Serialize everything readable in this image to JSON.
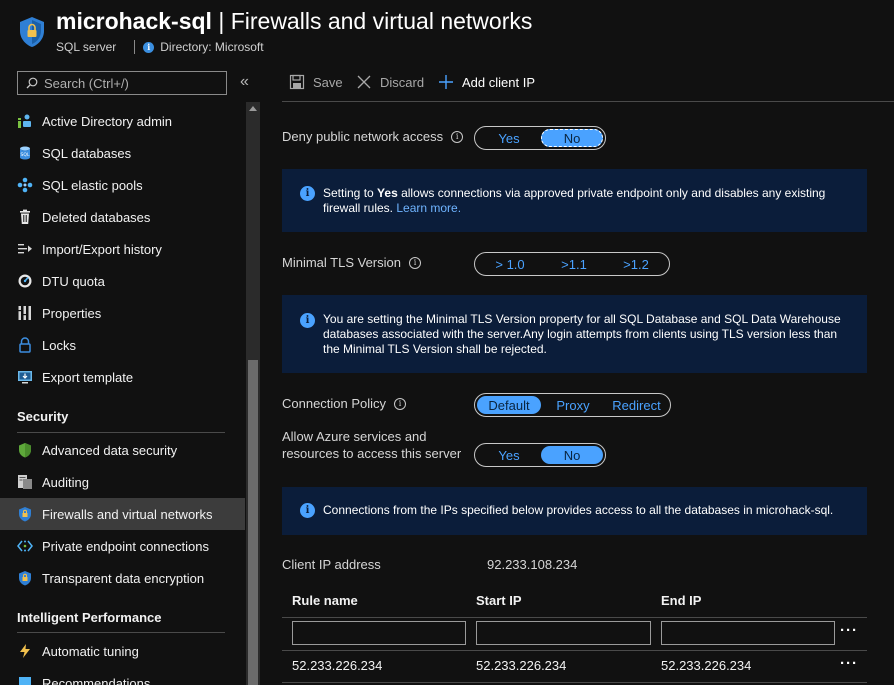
{
  "header": {
    "resource_name": "microhack-sql",
    "page_title": "| Firewalls and virtual networks",
    "resource_type": "SQL server",
    "directory": "Directory: Microsoft"
  },
  "sidebar": {
    "search_placeholder": "Search (Ctrl+/)",
    "collapse": "«",
    "items_top": [
      {
        "label": "Active Directory admin",
        "icon": "ad-admin-icon"
      },
      {
        "label": "SQL databases",
        "icon": "sql-database-icon"
      },
      {
        "label": "SQL elastic pools",
        "icon": "elastic-pool-icon"
      },
      {
        "label": "Deleted databases",
        "icon": "trash-icon"
      },
      {
        "label": "Import/Export history",
        "icon": "import-export-icon"
      },
      {
        "label": "DTU quota",
        "icon": "quota-gauge-icon"
      },
      {
        "label": "Properties",
        "icon": "properties-icon"
      },
      {
        "label": "Locks",
        "icon": "lock-icon"
      },
      {
        "label": "Export template",
        "icon": "export-template-icon"
      }
    ],
    "security_heading": "Security",
    "security_items": [
      {
        "label": "Advanced data security",
        "icon": "shield-green-icon"
      },
      {
        "label": "Auditing",
        "icon": "auditing-icon"
      },
      {
        "label": "Firewalls and virtual networks",
        "icon": "firewall-shield-icon",
        "active": true
      },
      {
        "label": "Private endpoint connections",
        "icon": "private-endpoint-icon"
      },
      {
        "label": "Transparent data encryption",
        "icon": "encryption-shield-icon"
      }
    ],
    "perf_heading": "Intelligent Performance",
    "perf_items": [
      {
        "label": "Automatic tuning",
        "icon": "lightning-icon"
      },
      {
        "label": "Recommendations",
        "icon": "recommendations-icon"
      }
    ]
  },
  "toolbar": {
    "save": "Save",
    "discard": "Discard",
    "add_client_ip": "Add client IP"
  },
  "deny_public": {
    "label": "Deny public network access",
    "yes": "Yes",
    "no": "No",
    "selected": "No"
  },
  "deny_info": {
    "pre": "Setting to ",
    "bold": "Yes",
    "post": " allows connections via approved private endpoint only and disables any existing firewall rules. ",
    "link": "Learn more."
  },
  "tls": {
    "label": "Minimal TLS Version",
    "options": [
      "> 1.0",
      ">1.1",
      ">1.2"
    ],
    "info": "You are setting the Minimal TLS Version property for all SQL Database and SQL Data Warehouse databases associated with the server.Any login attempts from clients using TLS version less than the Minimal TLS Version shall be rejected."
  },
  "connection_policy": {
    "label": "Connection Policy",
    "options": [
      "Default",
      "Proxy",
      "Redirect"
    ],
    "selected": "Default"
  },
  "allow_azure": {
    "label": "Allow Azure services and resources to access this server",
    "yes": "Yes",
    "no": "No",
    "selected": "No"
  },
  "ips_info": "Connections from the IPs specified below provides access to all the databases in microhack-sql.",
  "client_ip": {
    "label": "Client IP address",
    "value": "92.233.108.234"
  },
  "rules_table": {
    "columns": [
      "Rule name",
      "Start IP",
      "End IP"
    ],
    "new_row": {
      "rule_name": "",
      "start_ip": "",
      "end_ip": ""
    },
    "rows": [
      {
        "rule_name": "52.233.226.234",
        "start_ip": "52.233.226.234",
        "end_ip": "52.233.226.234"
      }
    ],
    "more": "···"
  },
  "colors": {
    "accent": "#4aa2ff",
    "info_bg": "#0b1d3a",
    "active_nav_bg": "#3c3c3c",
    "background": "#111111"
  }
}
